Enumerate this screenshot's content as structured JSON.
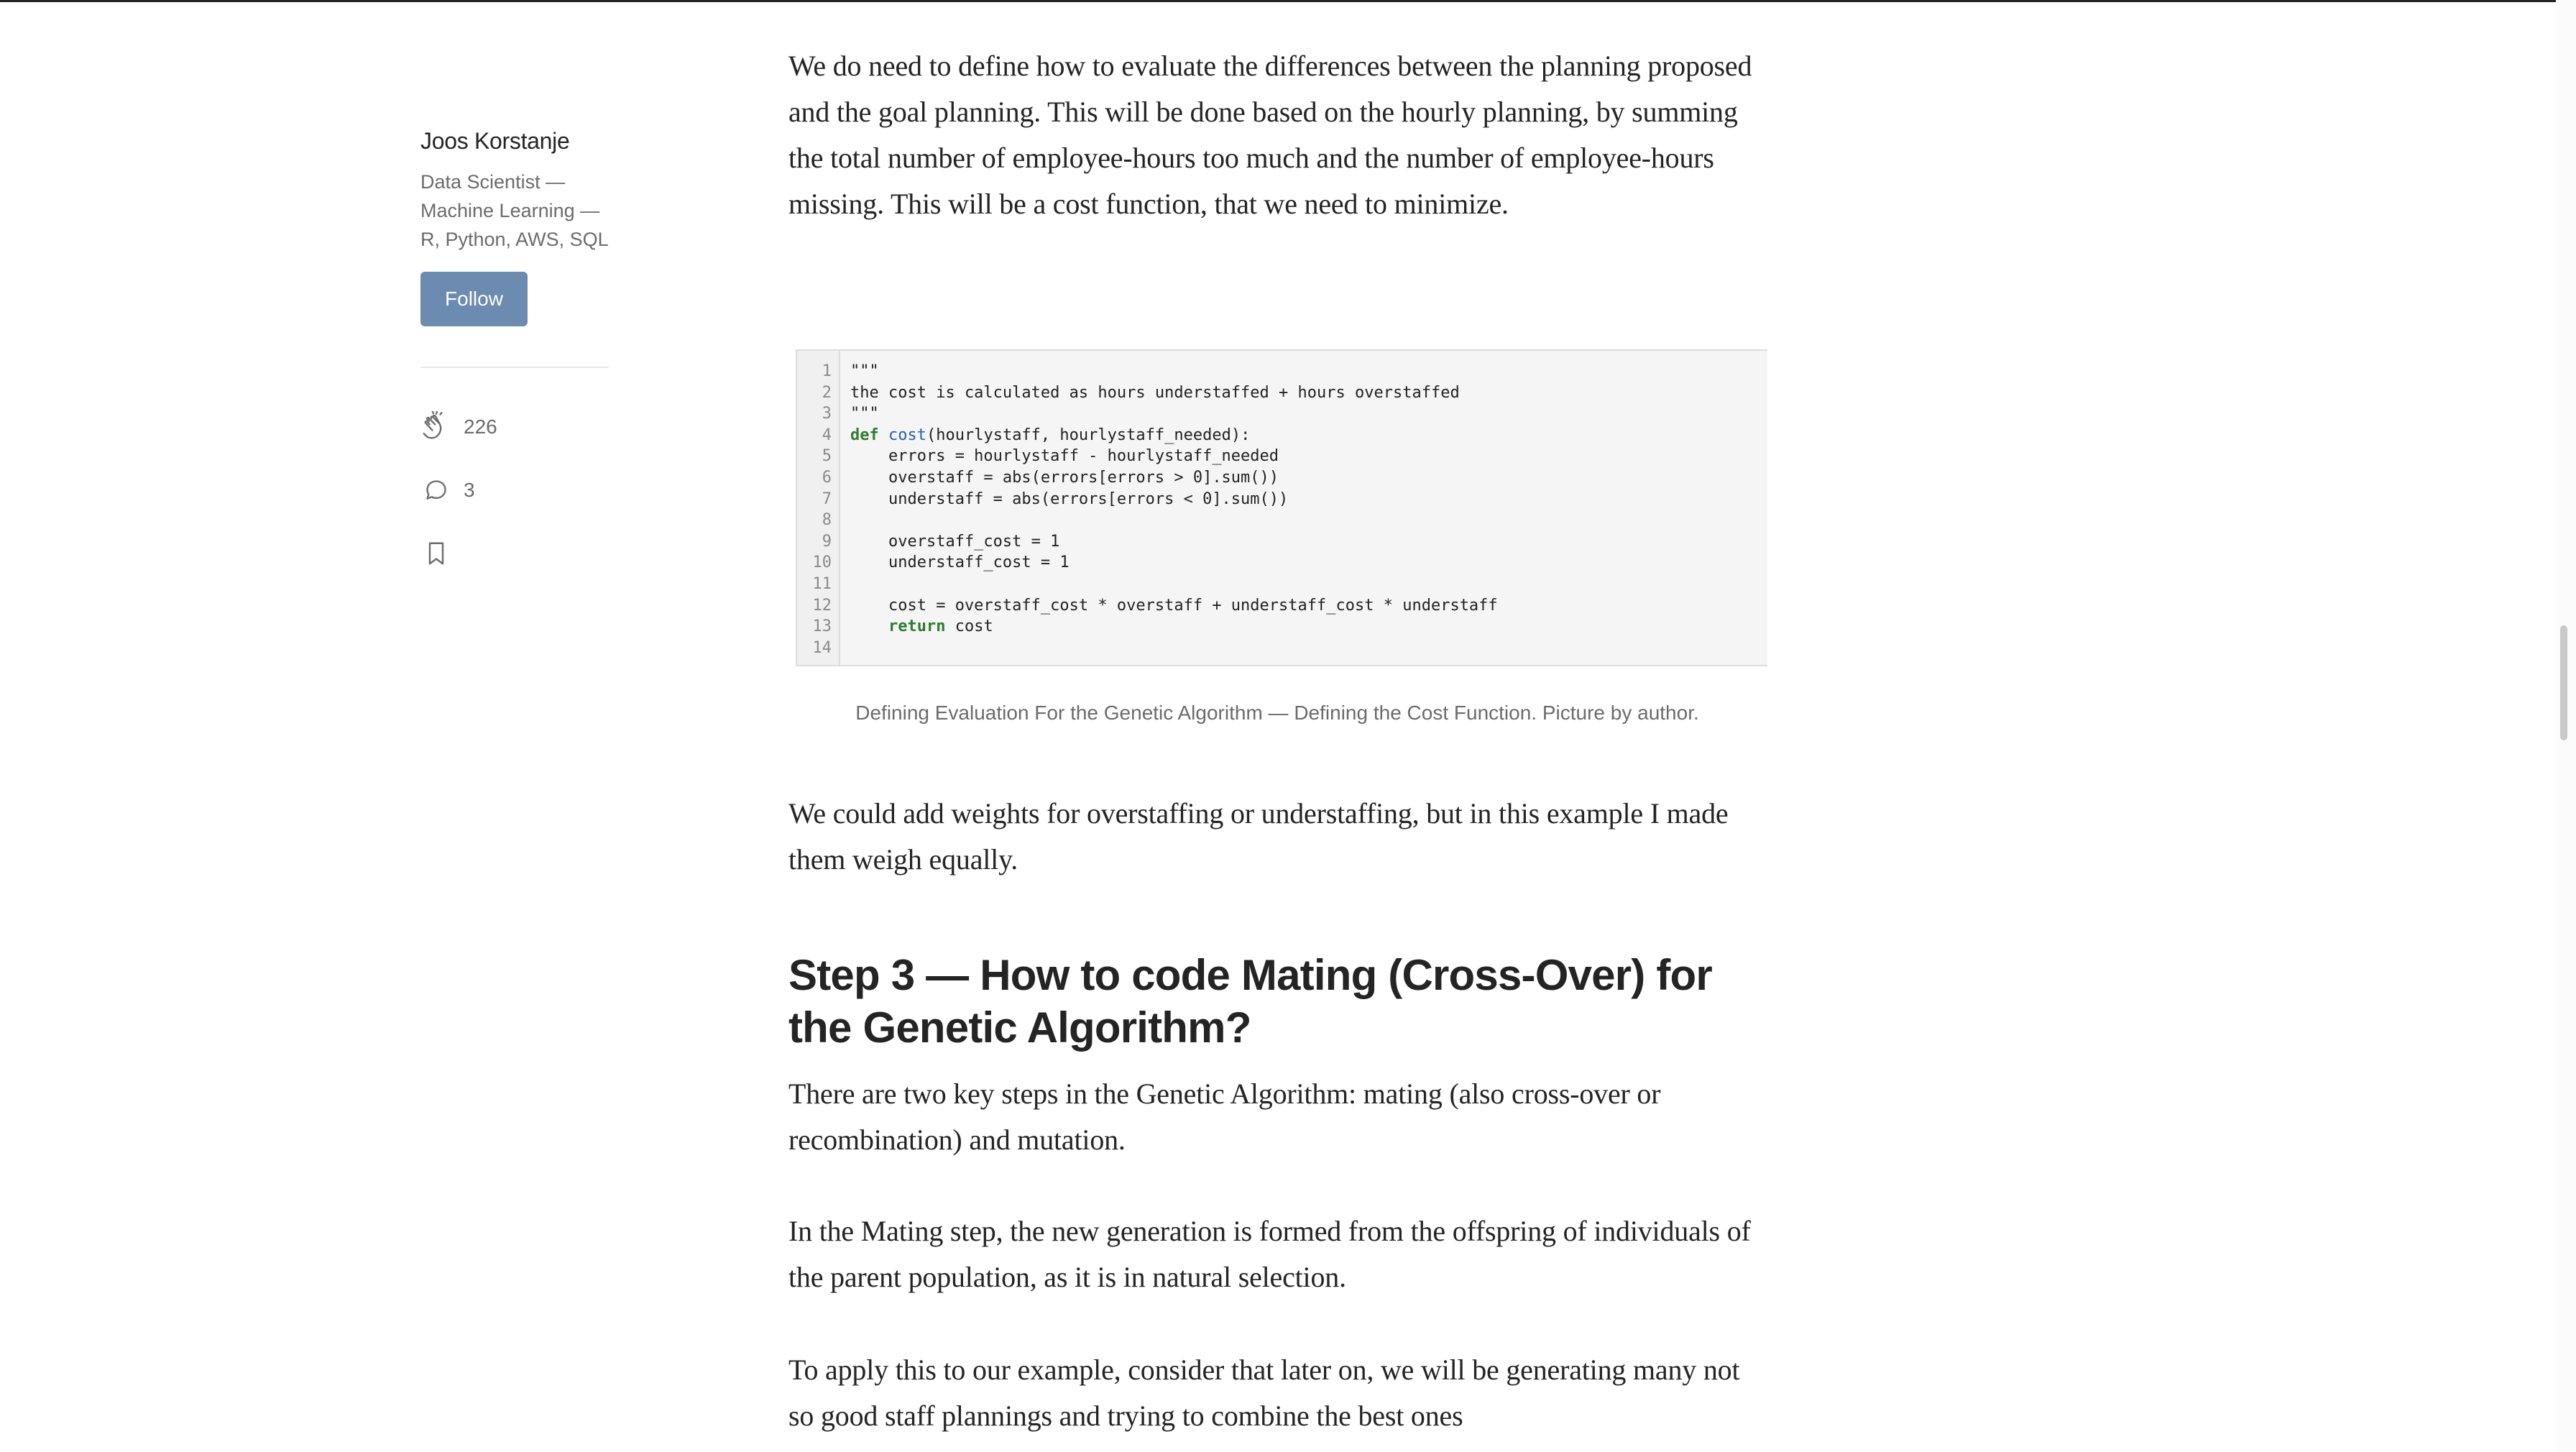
{
  "author": {
    "name": "Joos Korstanje",
    "bio_lines": [
      "Data Scientist —",
      "Machine Learning —",
      "R, Python, AWS, SQL"
    ],
    "follow_label": "Follow"
  },
  "stats": {
    "claps": "226",
    "responses": "3"
  },
  "article": {
    "para1": "We do need to define how to evaluate the differences between the planning proposed and the goal planning. This will be done based on the hourly planning, by summing the total number of employee-hours too much and the number of employee-hours missing. This will be a cost function, that we need to minimize.",
    "code_lines": [
      "1",
      "2",
      "3",
      "4",
      "5",
      "6",
      "7",
      "8",
      "9",
      "10",
      "11",
      "12",
      "13",
      "14"
    ],
    "code": {
      "l1": "\"\"\"",
      "l2": "the cost is calculated as hours understaffed + hours overstaffed",
      "l3": "\"\"\"",
      "l4_kw": "def",
      "l4_fn": "cost",
      "l4_rest": "(hourlystaff, hourlystaff_needed):",
      "l5": "    errors = hourlystaff - hourlystaff_needed",
      "l6": "    overstaff = abs(errors[errors > 0].sum())",
      "l7": "    understaff = abs(errors[errors < 0].sum())",
      "l9": "    overstaff_cost = 1",
      "l10": "    understaff_cost = 1",
      "l12": "    cost = overstaff_cost * overstaff + understaff_cost * understaff",
      "l13_kw": "return",
      "l13_rest": " cost"
    },
    "caption": "Defining Evaluation For the Genetic Algorithm — Defining the Cost Function. Picture by author.",
    "para2": "We could add weights for overstaffing or understaffing, but in this example I made them weigh equally.",
    "heading": "Step 3 — How to code Mating (Cross-Over) for the Genetic Algorithm?",
    "para3": "There are two key steps in the Genetic Algorithm: mating (also cross-over or recombination) and mutation.",
    "para4": "In the Mating step, the new generation is formed from the offspring of individuals of the parent population, as it is in natural selection.",
    "para5": "To apply this to our example, consider that later on, we will be generating many not so good staff plannings and trying to combine the best ones"
  }
}
